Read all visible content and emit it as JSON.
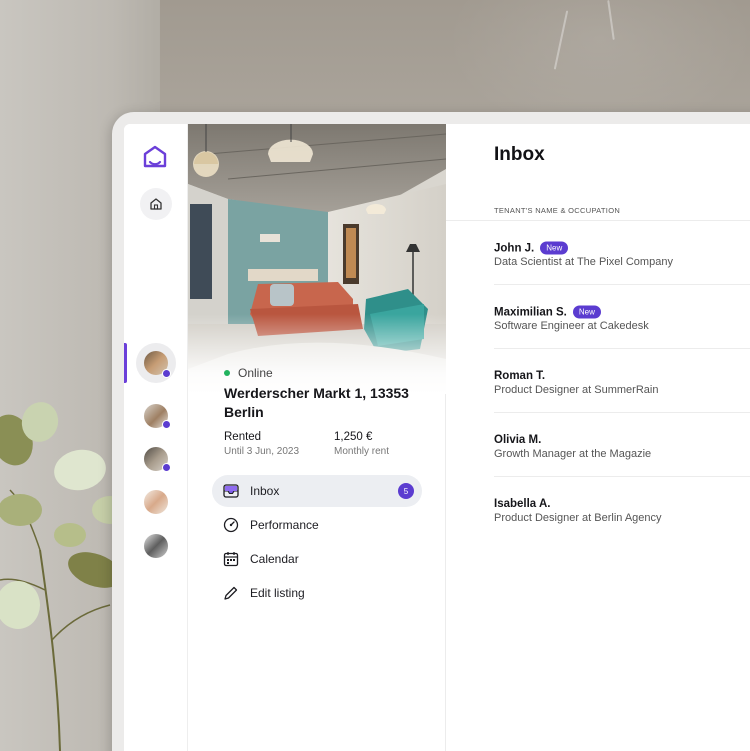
{
  "listing": {
    "status": "Online",
    "address": "Werderscher Markt 1, 13353 Berlin",
    "rented_label": "Rented",
    "rented_until": "Until 3 Jun, 2023",
    "rent_value": "1,250 €",
    "rent_label": "Monthly rent"
  },
  "menu": [
    {
      "label": "Inbox",
      "icon": "inbox-icon",
      "badge": "5"
    },
    {
      "label": "Performance",
      "icon": "gauge-icon"
    },
    {
      "label": "Calendar",
      "icon": "calendar-icon"
    },
    {
      "label": "Edit listing",
      "icon": "pencil-icon"
    }
  ],
  "inbox": {
    "title": "Inbox",
    "column_header": "TENANT'S NAME & OCCUPATION",
    "tenants": [
      {
        "name": "John J.",
        "badge": "New",
        "occupation": "Data Scientist at The Pixel Company"
      },
      {
        "name": "Maximilian S.",
        "badge": "New",
        "occupation": "Software Engineer at Cakedesk"
      },
      {
        "name": "Roman T.",
        "occupation": "Product Designer at SummerRain"
      },
      {
        "name": "Olivia M.",
        "occupation": "Growth Manager at the Magazie"
      },
      {
        "name": "Isabella A.",
        "occupation": "Product Designer at Berlin Agency"
      }
    ]
  },
  "colors": {
    "accent": "#5b3cd0",
    "online": "#22b35e"
  }
}
